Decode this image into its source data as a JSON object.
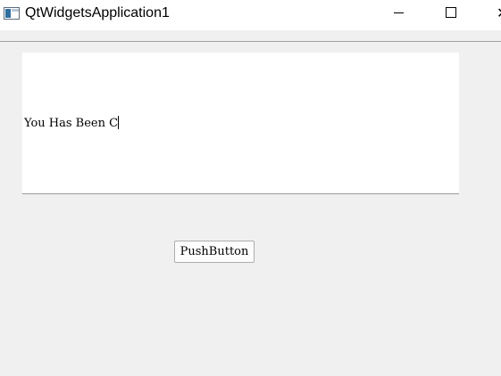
{
  "window": {
    "title": "QtWidgetsApplication1",
    "close_glyph": "✕",
    "icons": {
      "app": "app-window-icon",
      "minimize": "minimize-icon",
      "maximize": "maximize-icon",
      "close": "close-icon"
    }
  },
  "text_edit": {
    "value": "You Has Been C",
    "background": "#ffffff"
  },
  "push_button": {
    "label": "PushButton"
  },
  "colors": {
    "window_background": "#f0f0f0",
    "titlebar": "#ffffff"
  }
}
